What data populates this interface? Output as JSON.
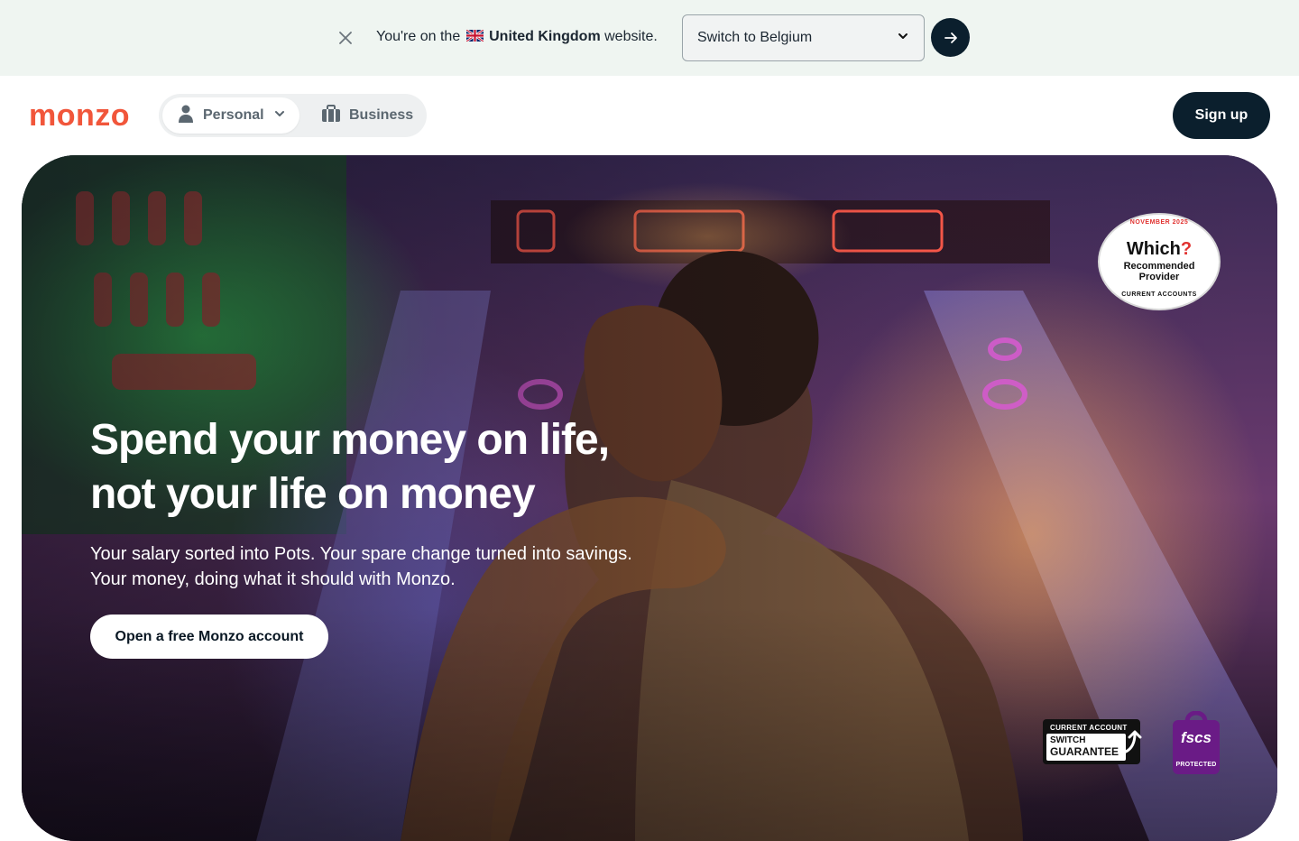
{
  "region_banner": {
    "text_before": "You're on the",
    "country": "United Kingdom",
    "text_after": "website.",
    "select_value": "Switch to Belgium"
  },
  "header": {
    "logo": "monzo",
    "nav": {
      "personal_label": "Personal",
      "business_label": "Business"
    },
    "signup_label": "Sign up"
  },
  "hero": {
    "title_line1": "Spend your money on life,",
    "title_line2": "not your life on money",
    "subtitle_line1": "Your salary sorted into Pots. Your spare change turned into savings.",
    "subtitle_line2": "Your money, doing what it should with Monzo.",
    "cta_label": "Open a free Monzo account"
  },
  "badges": {
    "which": {
      "top": "NOVEMBER 2025",
      "main": "Which",
      "mark": "?",
      "line1": "Recommended",
      "line2": "Provider",
      "bottom": "CURRENT ACCOUNTS"
    },
    "switch_guarantee": {
      "top": "CURRENT ACCOUNT",
      "line1": "SWITCH",
      "line2": "GUARANTEE"
    },
    "fscs": {
      "name": "fscs",
      "label": "PROTECTED"
    }
  },
  "colors": {
    "brand_coral": "#f1563b",
    "navy": "#0b1f2d",
    "banner_bg": "#eff5f1",
    "fscs_purple": "#6a1b86"
  }
}
